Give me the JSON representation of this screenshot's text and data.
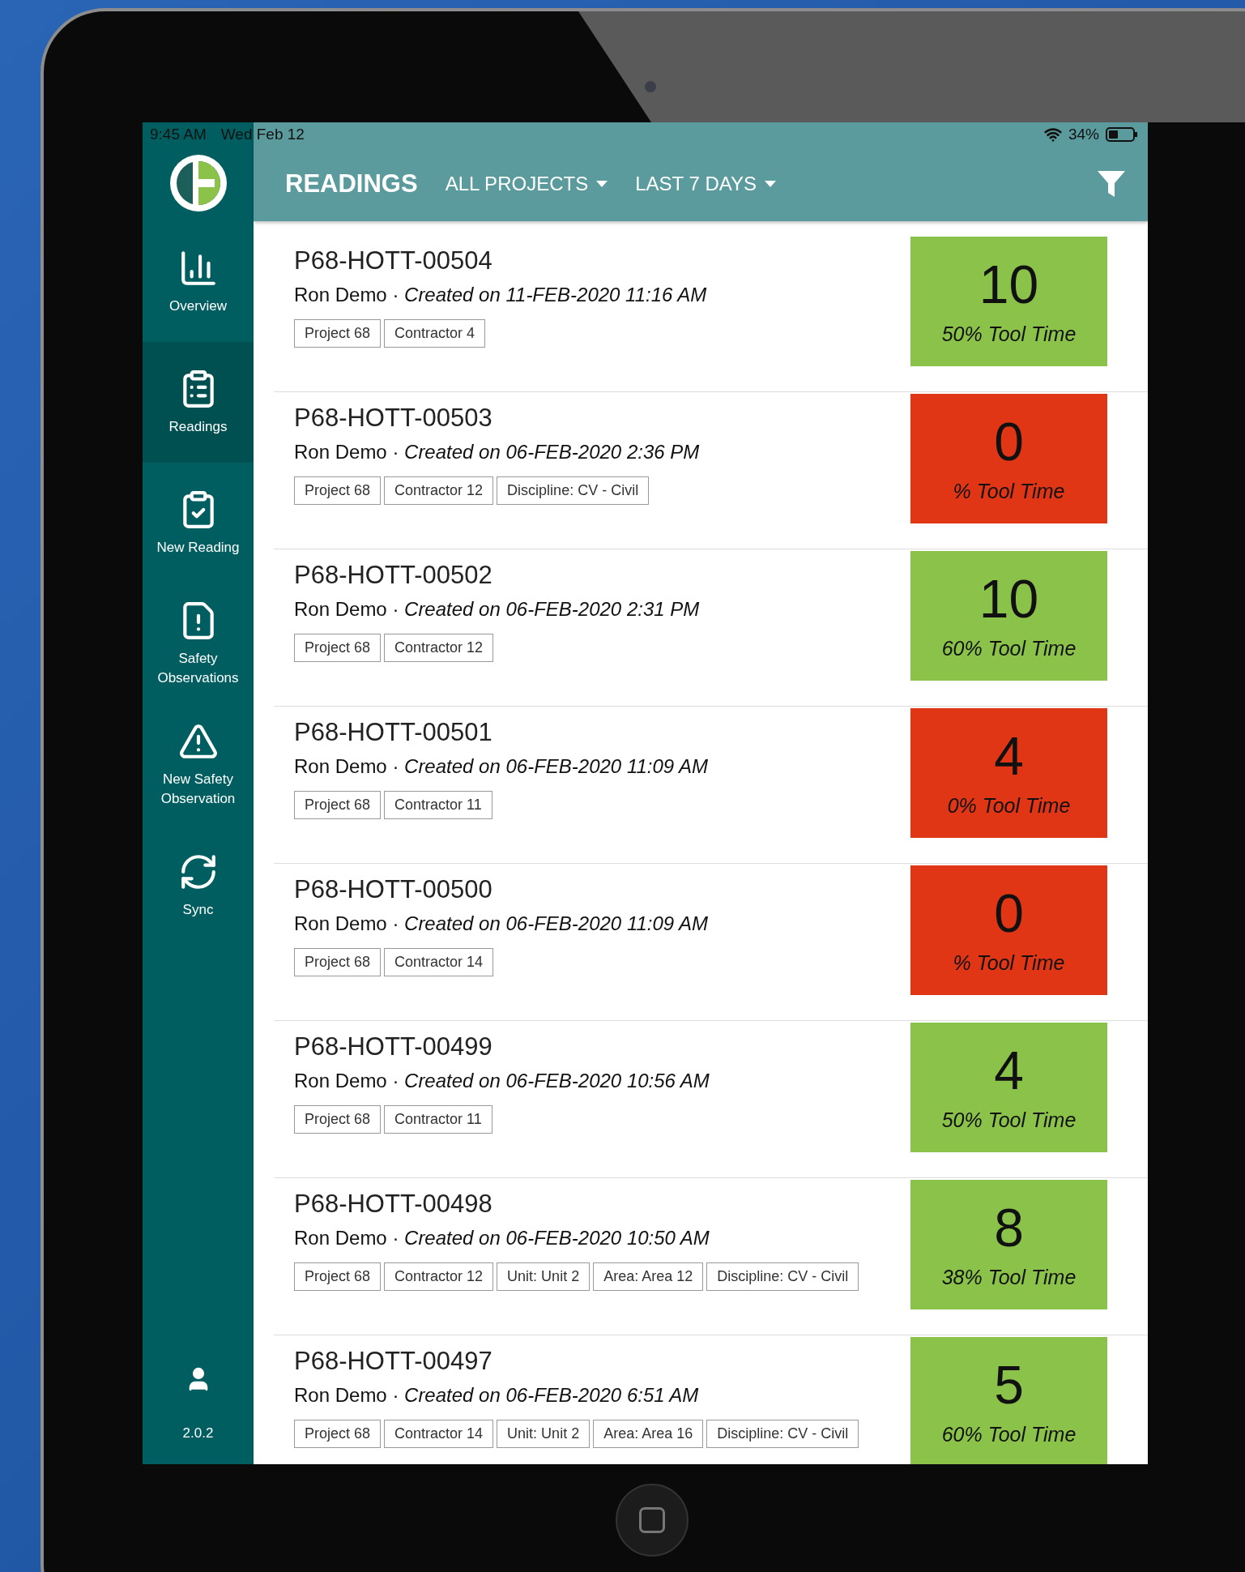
{
  "status_bar": {
    "time": "9:45 AM",
    "date": "Wed Feb 12",
    "battery": "34%"
  },
  "sidebar": {
    "items": [
      {
        "kind": "overview",
        "label": "Overview",
        "selected": false
      },
      {
        "kind": "readings",
        "label": "Readings",
        "selected": true
      },
      {
        "kind": "new-reading",
        "label": "New Reading",
        "selected": false
      },
      {
        "kind": "safety",
        "label": "Safety Observations",
        "selected": false
      },
      {
        "kind": "new-safety",
        "label": "New Safety Observation",
        "selected": false
      },
      {
        "kind": "sync",
        "label": "Sync",
        "selected": false
      }
    ],
    "version": "2.0.2"
  },
  "header": {
    "title": "READINGS",
    "filters": [
      {
        "label": "ALL PROJECTS"
      },
      {
        "label": "LAST 7 DAYS"
      }
    ]
  },
  "readings": [
    {
      "id": "P68-HOTT-00504",
      "meta": "Ron Demo · *Created on 11-FEB-2020 11:16 AM*",
      "tags": [
        "Project 68",
        "Contractor 4"
      ],
      "score": "10",
      "tool_time": "50% Tool Time",
      "color": "#8bc34a"
    },
    {
      "id": "P68-HOTT-00503",
      "meta": "Ron Demo · *Created on 06-FEB-2020 2:36 PM*",
      "tags": [
        "Project 68",
        "Contractor 12",
        "Discipline: CV - Civil"
      ],
      "score": "0",
      "tool_time": "% Tool Time",
      "color": "#e03616"
    },
    {
      "id": "P68-HOTT-00502",
      "meta": "Ron Demo · *Created on 06-FEB-2020 2:31 PM*",
      "tags": [
        "Project 68",
        "Contractor 12"
      ],
      "score": "10",
      "tool_time": "60% Tool Time",
      "color": "#8bc34a"
    },
    {
      "id": "P68-HOTT-00501",
      "meta": "Ron Demo · *Created on 06-FEB-2020 11:09 AM*",
      "tags": [
        "Project 68",
        "Contractor 11"
      ],
      "score": "4",
      "tool_time": "0% Tool Time",
      "color": "#e03616"
    },
    {
      "id": "P68-HOTT-00500",
      "meta": "Ron Demo · *Created on 06-FEB-2020 11:09 AM*",
      "tags": [
        "Project 68",
        "Contractor 14"
      ],
      "score": "0",
      "tool_time": "% Tool Time",
      "color": "#e03616"
    },
    {
      "id": "P68-HOTT-00499",
      "meta": "Ron Demo · *Created on 06-FEB-2020 10:56 AM*",
      "tags": [
        "Project 68",
        "Contractor 11"
      ],
      "score": "4",
      "tool_time": "50% Tool Time",
      "color": "#8bc34a"
    },
    {
      "id": "P68-HOTT-00498",
      "meta": "Ron Demo · *Created on 06-FEB-2020 10:50 AM*",
      "tags": [
        "Project 68",
        "Contractor 12",
        "Unit: Unit 2",
        "Area: Area 12",
        "Discipline: CV - Civil"
      ],
      "score": "8",
      "tool_time": "38% Tool Time",
      "color": "#8bc34a"
    },
    {
      "id": "P68-HOTT-00497",
      "meta": "Ron Demo · *Created on 06-FEB-2020 6:51 AM*",
      "tags": [
        "Project 68",
        "Contractor 14",
        "Unit: Unit 2",
        "Area: Area 16",
        "Discipline: CV - Civil"
      ],
      "score": "5",
      "tool_time": "60% Tool Time",
      "color": "#8bc34a"
    }
  ]
}
